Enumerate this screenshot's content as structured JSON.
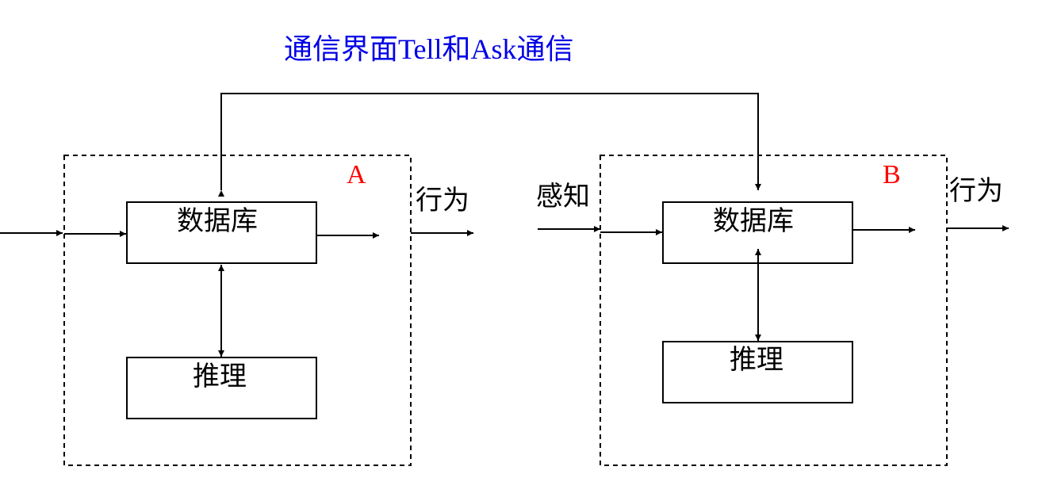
{
  "title": "通信界面Tell和Ask通信",
  "colors": {
    "title": "#0000e6",
    "agent_tag": "#ff0000",
    "line": "#000000"
  },
  "agent_a": {
    "tag": "A",
    "database_label": "数据库",
    "reasoning_label": "推理",
    "output_label": "行为"
  },
  "agent_b": {
    "tag": "B",
    "input_label": "感知",
    "database_label": "数据库",
    "reasoning_label": "推理",
    "output_label": "行为"
  }
}
